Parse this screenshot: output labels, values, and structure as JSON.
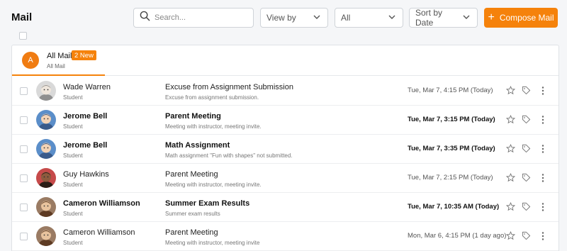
{
  "page": {
    "title": "Mail"
  },
  "toolbar": {
    "search_placeholder": "Search...",
    "view_by": "View by",
    "filter": "All",
    "sort": "Sort by Date",
    "compose": "Compose Mail",
    "accent_color": "#f5820b"
  },
  "folder": {
    "avatar_letter": "A",
    "name": "All Mail",
    "badge": "2 New",
    "sub": "All Mail"
  },
  "mails": [
    {
      "sender": "Wade Warren",
      "role": "Student",
      "subject": "Excuse from Assignment Submission",
      "preview": "Excuse from assignment submission.",
      "date": "Tue, Mar 7, 4:15 PM (Today)",
      "unread": false
    },
    {
      "sender": "Jerome Bell",
      "role": "Student",
      "subject": "Parent Meeting",
      "preview": "Meeting with instructor, meeting invite.",
      "date": "Tue, Mar 7, 3:15 PM (Today)",
      "unread": true
    },
    {
      "sender": "Jerome Bell",
      "role": "Student",
      "subject": "Math Assignment",
      "preview": "Math assignment \"Fun with shapes\" not submitted.",
      "date": "Tue, Mar 7, 3:35 PM (Today)",
      "unread": true
    },
    {
      "sender": "Guy Hawkins",
      "role": "Student",
      "subject": "Parent Meeting",
      "preview": "Meeting with instructor, meeting invite.",
      "date": "Tue, Mar 7, 2:15 PM (Today)",
      "unread": false
    },
    {
      "sender": "Cameron Williamson",
      "role": "Student",
      "subject": "Summer Exam Results",
      "preview": "Summer exam results",
      "date": "Tue, Mar 7, 10:35 AM (Today)",
      "unread": true
    },
    {
      "sender": "Cameron Williamson",
      "role": "Student",
      "subject": "Parent Meeting",
      "preview": "Meeting with instructor, meeting invite",
      "date": "Mon, Mar 6, 4:15 PM (1 day ago)",
      "unread": false
    }
  ]
}
